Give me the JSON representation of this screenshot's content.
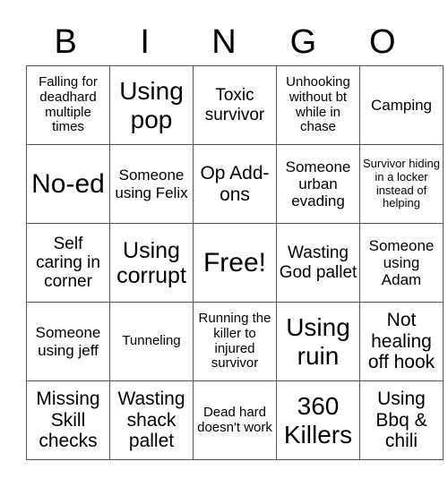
{
  "title_letters": [
    "B",
    "I",
    "N",
    "G",
    "O"
  ],
  "board": [
    [
      "Falling for deadhard multiple times",
      "Using pop",
      "Toxic survivor",
      "Unhooking without bt while in chase",
      "Camping"
    ],
    [
      "No-ed",
      "Someone using Felix",
      "Op Add-ons",
      "Someone urban evading",
      "Survivor hiding in a locker instead of helping"
    ],
    [
      "Self caring in corner",
      "Using corrupt",
      "Free!",
      "Wasting God pallet",
      "Someone using Adam"
    ],
    [
      "Someone using jeff",
      "Tunneling",
      "Running the killer to injured survivor",
      "Using ruin",
      "Not healing off hook"
    ],
    [
      "Missing Skill checks",
      "Wasting shack pallet",
      "Dead hard doesn't work",
      "360 Killers",
      "Using Bbq & chili"
    ]
  ]
}
